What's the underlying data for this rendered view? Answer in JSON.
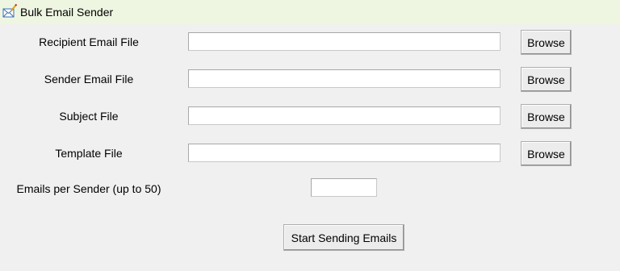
{
  "window": {
    "title": "Bulk Email Sender",
    "icon": "envelope-pen-icon"
  },
  "form": {
    "recipient_label": "Recipient Email File",
    "sender_label": "Sender Email File",
    "subject_label": "Subject File",
    "template_label": "Template File",
    "emails_per_sender_label": "Emails per Sender (up to 50)",
    "recipient_value": "",
    "sender_value": "",
    "subject_value": "",
    "template_value": "",
    "emails_per_sender_value": "",
    "browse_label": "Browse",
    "start_label": "Start Sending Emails"
  }
}
